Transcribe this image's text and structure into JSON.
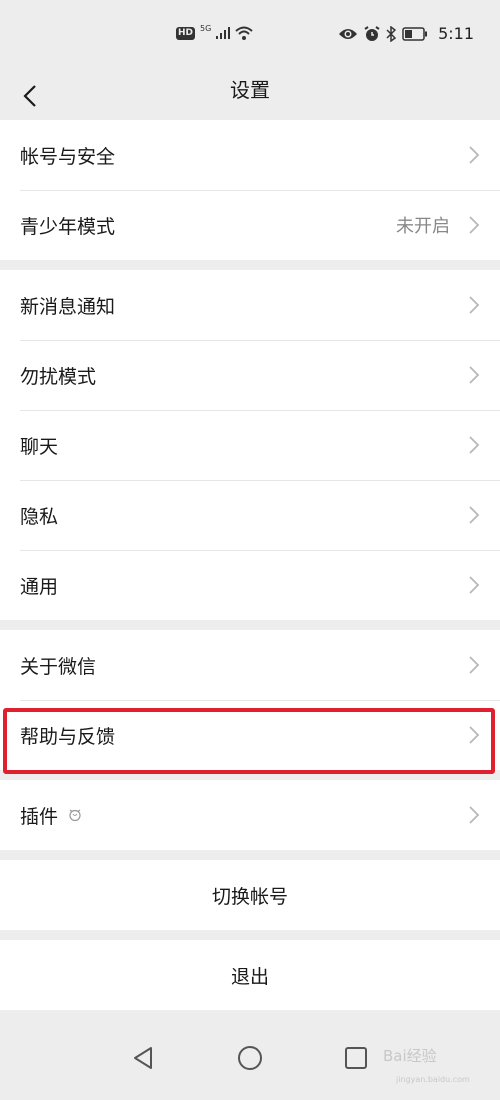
{
  "status_bar": {
    "hd_badge": "HD",
    "network_type": "5G",
    "time": "5:11",
    "icons": [
      "signal-icon",
      "wifi-icon",
      "eye-icon",
      "alarm-icon",
      "bluetooth-icon",
      "battery-icon"
    ]
  },
  "header": {
    "title": "设置",
    "back_icon": "chevron-left-icon"
  },
  "groups": [
    {
      "items": [
        {
          "label": "帐号与安全"
        },
        {
          "label": "青少年模式",
          "value": "未开启"
        }
      ]
    },
    {
      "items": [
        {
          "label": "新消息通知"
        },
        {
          "label": "勿扰模式"
        },
        {
          "label": "聊天"
        },
        {
          "label": "隐私"
        },
        {
          "label": "通用"
        }
      ]
    },
    {
      "items": [
        {
          "label": "关于微信"
        },
        {
          "label": "帮助与反馈"
        }
      ]
    },
    {
      "items": [
        {
          "label": "插件",
          "icon": "plugin-badge-icon"
        }
      ]
    }
  ],
  "actions": {
    "switch_account": "切换帐号",
    "logout": "退出"
  },
  "highlight": {
    "target": "帮助与反馈",
    "color": "#e0202f"
  },
  "system_nav": {
    "icons": [
      "back-triangle-icon",
      "home-circle-icon",
      "recents-square-icon"
    ]
  },
  "watermark": {
    "text": "Bai经验",
    "sub": "jingyan.baidu.com"
  },
  "colors": {
    "background": "#ededed",
    "card": "#ffffff",
    "secondary_text": "#888888",
    "highlight": "#e0202f"
  }
}
